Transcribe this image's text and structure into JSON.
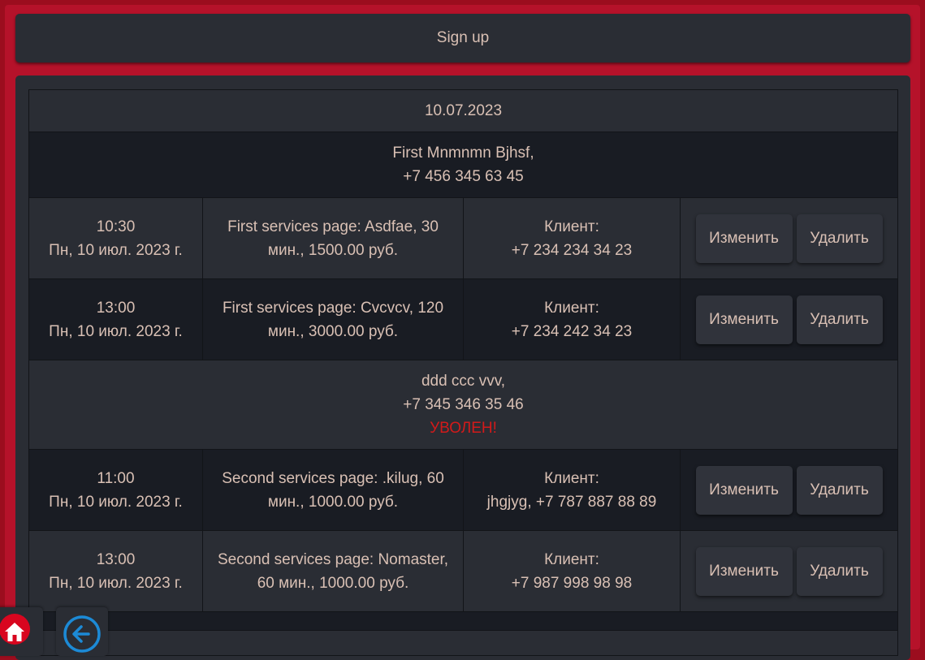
{
  "signup": {
    "label": "Sign up"
  },
  "schedule": {
    "date": "10.07.2023",
    "masters": [
      {
        "name": "First Mnmnmn Bjhsf,",
        "phone": "+7 456 345 63 45",
        "status": "",
        "appointments": [
          {
            "time": "10:30",
            "day": "Пн, 10 июл. 2023 г.",
            "service_line1": "First services page: Asdfae, 30",
            "service_line2": "мин., 1500.00 руб.",
            "client_label": "Клиент:",
            "client": "+7 234 234 34 23"
          },
          {
            "time": "13:00",
            "day": "Пн, 10 июл. 2023 г.",
            "service_line1": "First services page: Cvcvcv, 120",
            "service_line2": "мин., 3000.00 руб.",
            "client_label": "Клиент:",
            "client": "+7 234 242 34 23"
          }
        ]
      },
      {
        "name": "ddd ccc vvv,",
        "phone": "+7 345 346 35 46",
        "status": "УВОЛЕН!",
        "appointments": [
          {
            "time": "11:00",
            "day": "Пн, 10 июл. 2023 г.",
            "service_line1": "Second services page: .kilug, 60",
            "service_line2": "мин., 1000.00 руб.",
            "client_label": "Клиент:",
            "client": "jhgjyg, +7 787 887 88 89"
          },
          {
            "time": "13:00",
            "day": "Пн, 10 июл. 2023 г.",
            "service_line1": "Second services page: Nomaster,",
            "service_line2": "60 мин., 1000.00 руб.",
            "client_label": "Клиент:",
            "client": "+7 987 998 98 98"
          }
        ]
      }
    ]
  },
  "actions": {
    "edit_label": "Изменить",
    "delete_label": "Удалить"
  },
  "nav": {
    "home_icon": "home-icon",
    "back_icon": "arrow-left-icon"
  },
  "colors": {
    "accent": "#9b0d1e",
    "panel": "#2a2d34",
    "text": "#d9c0b4",
    "fired": "#d21a1a",
    "home": "#d8061f",
    "back": "#1c8ad6"
  }
}
